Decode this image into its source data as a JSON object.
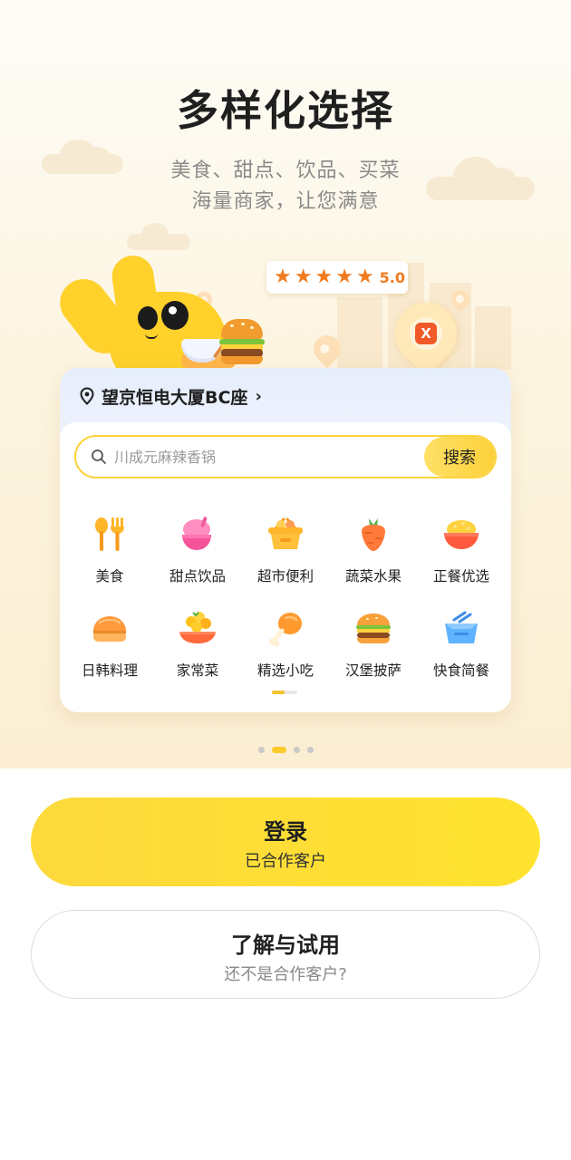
{
  "hero": {
    "title": "多样化选择",
    "subtitle_line1": "美食、甜点、饮品、买菜",
    "subtitle_line2": "海量商家，让您满意",
    "rating": {
      "stars": 5,
      "score": "5.0"
    },
    "promo_logo_char": "X"
  },
  "card": {
    "location": "望京恒电大厦BC座",
    "location_arrow": "›",
    "search": {
      "placeholder": "川成元麻辣香锅",
      "button": "搜索"
    },
    "categories": [
      {
        "label": "美食",
        "icon": "fork-spoon-icon"
      },
      {
        "label": "甜点饮品",
        "icon": "dessert-cup-icon"
      },
      {
        "label": "超市便利",
        "icon": "basket-icon"
      },
      {
        "label": "蔬菜水果",
        "icon": "carrot-icon"
      },
      {
        "label": "正餐优选",
        "icon": "rice-bowl-icon"
      },
      {
        "label": "日韩料理",
        "icon": "sushi-icon"
      },
      {
        "label": "家常菜",
        "icon": "home-dish-icon"
      },
      {
        "label": "精选小吃",
        "icon": "drumstick-icon"
      },
      {
        "label": "汉堡披萨",
        "icon": "burger-icon"
      },
      {
        "label": "快食简餐",
        "icon": "takeout-box-icon"
      }
    ]
  },
  "carousel": {
    "total": 4,
    "active_index": 1
  },
  "actions": {
    "login": {
      "title": "登录",
      "subtitle": "已合作客户"
    },
    "trial": {
      "title": "了解与试用",
      "subtitle": "还不是合作客户?"
    }
  },
  "colors": {
    "accent": "#FCD33C",
    "orange": "#F07B1F",
    "text": "#1F1F1F",
    "muted": "#8A8A8A"
  }
}
